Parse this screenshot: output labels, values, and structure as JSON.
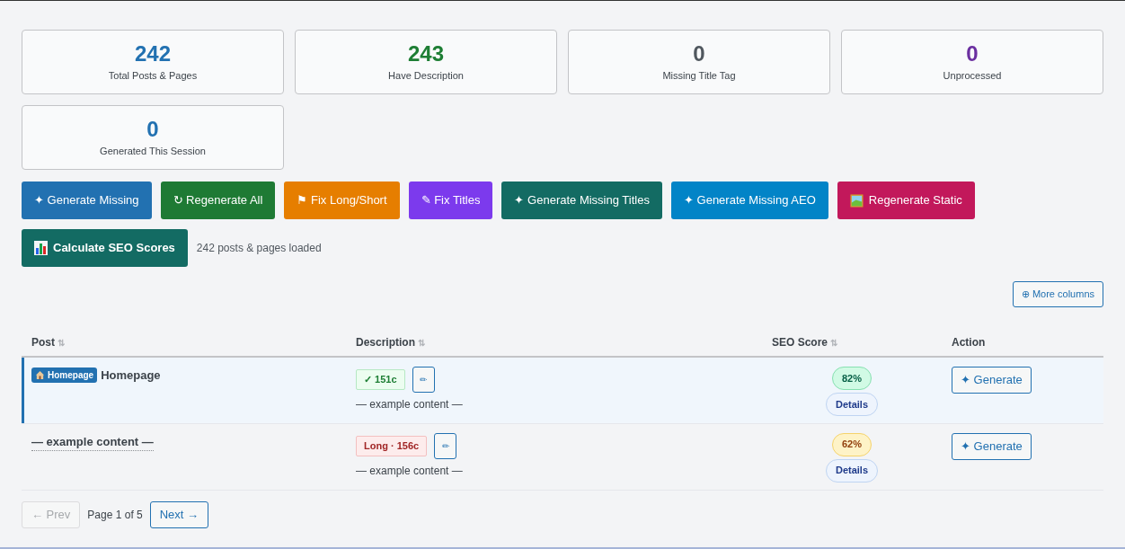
{
  "stats": [
    {
      "value": "242",
      "label": "Total Posts & Pages",
      "color": "#2271b1"
    },
    {
      "value": "243",
      "label": "Have Description",
      "color": "#1e7e34"
    },
    {
      "value": "0",
      "label": "Missing Title Tag",
      "color": "#50575e"
    },
    {
      "value": "0",
      "label": "Unprocessed",
      "color": "#6b2fa0"
    },
    {
      "value": "0",
      "label": "Generated This Session",
      "color": "#2271b1"
    }
  ],
  "actions": [
    {
      "kind": "glyph",
      "glyph": "✦",
      "label": "Generate Missing",
      "color": "#2271b1"
    },
    {
      "kind": "glyph",
      "glyph": "↻",
      "label": "Regenerate All",
      "color": "#1e7a34"
    },
    {
      "kind": "glyph",
      "glyph": "⚑",
      "label": "Fix Long/Short",
      "color": "#e67e00"
    },
    {
      "kind": "glyph",
      "glyph": "✎",
      "label": "Fix Titles",
      "color": "#7c3aed"
    },
    {
      "kind": "glyph",
      "glyph": "✦",
      "label": "Generate Missing Titles",
      "color": "#136b63"
    },
    {
      "kind": "glyph",
      "glyph": "✦",
      "label": "Generate Missing AEO",
      "color": "#0284c7"
    },
    {
      "kind": "image",
      "label": "Regenerate Static",
      "color": "#c2185b"
    },
    {
      "kind": "chart",
      "label": "Calculate SEO Scores",
      "color": "#136b63"
    }
  ],
  "status_text": "242 posts & pages loaded",
  "more_columns": {
    "glyph": "⊕",
    "label": "More columns"
  },
  "table": {
    "columns": [
      {
        "label": "Post",
        "sortable": true
      },
      {
        "label": "Description",
        "sortable": true
      },
      {
        "label": "SEO Score",
        "sortable": true
      },
      {
        "label": "Action",
        "sortable": false
      }
    ],
    "sort_glyph": "⇅",
    "rows": [
      {
        "selected": true,
        "tag": "Homepage",
        "title": "Homepage",
        "link": false,
        "desc_badge": {
          "kind": "ok",
          "text": "✓ 151c"
        },
        "edit_glyph": "✏",
        "description": "— example content —",
        "score": {
          "kind": "good",
          "text": "82%"
        },
        "details": "Details",
        "action": "✦ Generate"
      },
      {
        "selected": false,
        "title": "— example content —",
        "link": true,
        "desc_badge": {
          "kind": "long",
          "text": "Long · 156c"
        },
        "edit_glyph": "✏",
        "description": "— example content —",
        "score": {
          "kind": "fair",
          "text": "62%"
        },
        "details": "Details",
        "action": "✦ Generate"
      }
    ]
  },
  "pagination": {
    "prev": {
      "label": "← Prev",
      "disabled": true
    },
    "info": "Page 1 of 5",
    "next": {
      "label": "Next →",
      "disabled": false
    }
  }
}
